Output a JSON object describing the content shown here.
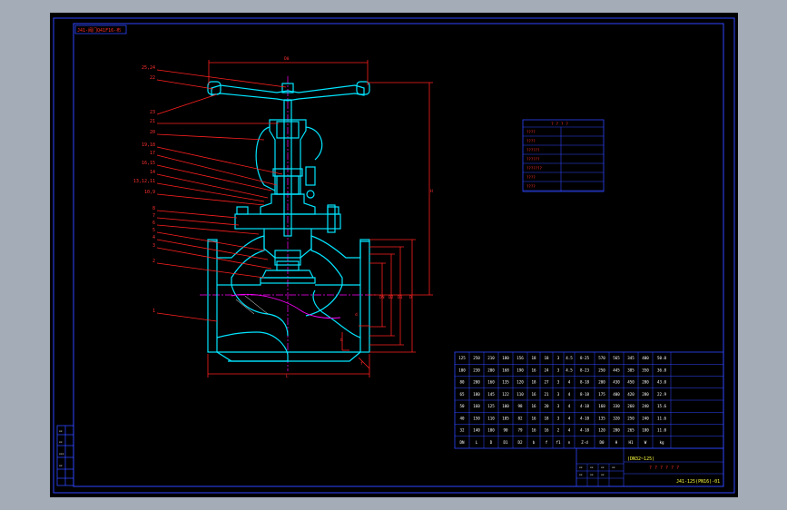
{
  "colors": {
    "background": "#000000",
    "frame": "#2f46ff",
    "outline": "#00e5ff",
    "dimension": "#ff2020",
    "centerline": "#ff00ff",
    "text_table": "#ffffff",
    "text_title": "#ffff40"
  },
  "title_tag": "J41-阀门Q41F16-布",
  "dims": {
    "top": "D0",
    "height": "H"
  },
  "callouts": [
    "25,24",
    "22",
    "23",
    "21",
    "20",
    "19,18",
    "17",
    "16,15",
    "14",
    "13,12,11",
    "10,9",
    "8",
    "7",
    "6",
    "5",
    "4",
    "3",
    "2",
    "1"
  ],
  "legend_table": {
    "header": "? ? ? ?",
    "rows": [
      "????",
      "????",
      "??????",
      "??????",
      "???????",
      "????",
      "????"
    ]
  },
  "spec_table": {
    "rows": [
      [
        "125",
        "250",
        "210",
        "180",
        "156",
        "18",
        "18",
        "3",
        "4.5",
        "8-25",
        "570",
        "565",
        "345",
        "400",
        "50.0"
      ],
      [
        "100",
        "230",
        "200",
        "168",
        "190",
        "16",
        "24",
        "3",
        "4.5",
        "8-23",
        "250",
        "445",
        "385",
        "350",
        "36.8"
      ],
      [
        "80",
        "200",
        "160",
        "135",
        "120",
        "18",
        "27",
        "3",
        "4",
        "8-18",
        "200",
        "430",
        "450",
        "280",
        "43.0"
      ],
      [
        "65",
        "180",
        "145",
        "122",
        "110",
        "16",
        "21",
        "3",
        "4",
        "8-18",
        "175",
        "400",
        "420",
        "280",
        "22.9"
      ],
      [
        "50",
        "160",
        "125",
        "100",
        "98",
        "16",
        "20",
        "3",
        "4",
        "4-18",
        "160",
        "330",
        "260",
        "240",
        "15.6"
      ],
      [
        "40",
        "150",
        "110",
        "105",
        "82",
        "16",
        "18",
        "3",
        "4",
        "4-18",
        "135",
        "320",
        "250",
        "240",
        "11.6"
      ],
      [
        "32",
        "140",
        "100",
        "90",
        "79",
        "16",
        "16",
        "2",
        "4",
        "4-18",
        "120",
        "280",
        "265",
        "180",
        "11.0"
      ],
      [
        "DN",
        "L",
        "D",
        "D1",
        "D2",
        "b",
        "f",
        "f1",
        "n",
        "Z-d",
        "D0",
        "H",
        "H1",
        "W",
        "kg"
      ]
    ]
  },
  "title_block": {
    "model": "(DN32~125)",
    "chars": "? ? ? ? ? ?",
    "code": "J41-125(PN16)-01"
  }
}
